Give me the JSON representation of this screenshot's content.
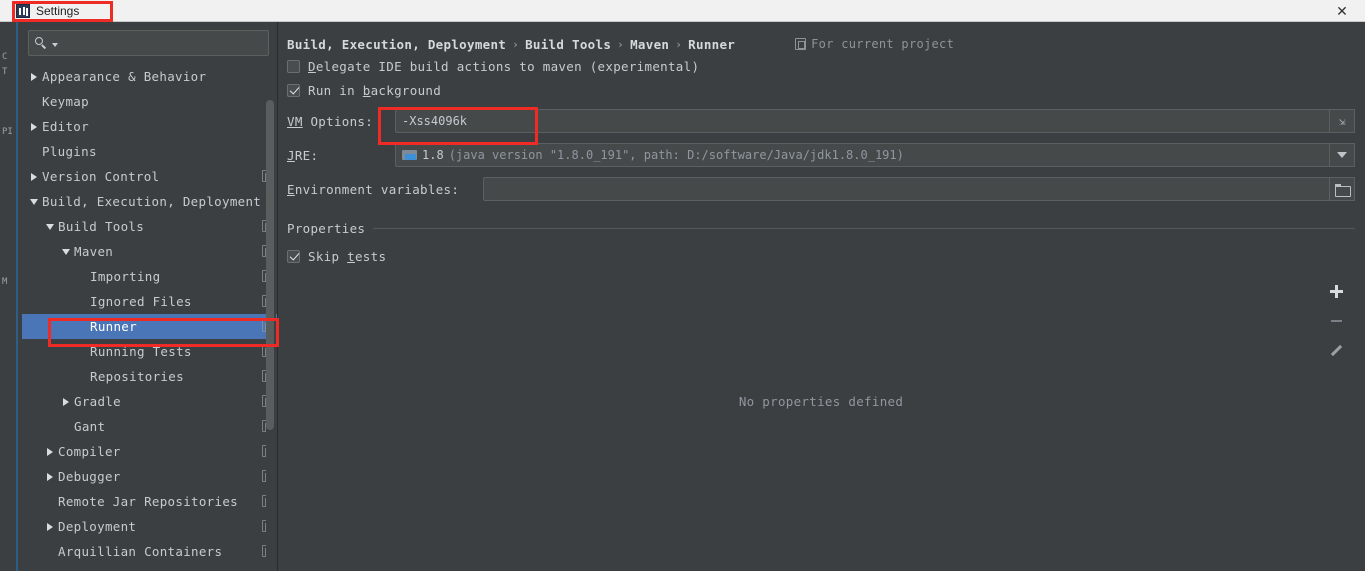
{
  "window": {
    "title": "Settings",
    "close_label": "✕",
    "icon": "ide-logo-icon"
  },
  "sidebar": {
    "search": {
      "value": "",
      "placeholder": ""
    },
    "items": [
      {
        "label": "Appearance & Behavior",
        "arrow": "right",
        "indent": 0,
        "scope_icon": false,
        "selected": false
      },
      {
        "label": "Keymap",
        "arrow": "none",
        "indent": 0,
        "scope_icon": false,
        "selected": false
      },
      {
        "label": "Editor",
        "arrow": "right",
        "indent": 0,
        "scope_icon": false,
        "selected": false
      },
      {
        "label": "Plugins",
        "arrow": "none",
        "indent": 0,
        "scope_icon": false,
        "selected": false
      },
      {
        "label": "Version Control",
        "arrow": "right",
        "indent": 0,
        "scope_icon": true,
        "selected": false
      },
      {
        "label": "Build, Execution, Deployment",
        "arrow": "down",
        "indent": 0,
        "scope_icon": false,
        "selected": false
      },
      {
        "label": "Build Tools",
        "arrow": "down",
        "indent": 1,
        "scope_icon": true,
        "selected": false
      },
      {
        "label": "Maven",
        "arrow": "down",
        "indent": 2,
        "scope_icon": true,
        "selected": false
      },
      {
        "label": "Importing",
        "arrow": "none",
        "indent": 3,
        "scope_icon": true,
        "selected": false
      },
      {
        "label": "Ignored Files",
        "arrow": "none",
        "indent": 3,
        "scope_icon": true,
        "selected": false
      },
      {
        "label": "Runner",
        "arrow": "none",
        "indent": 3,
        "scope_icon": true,
        "selected": true
      },
      {
        "label": "Running Tests",
        "arrow": "none",
        "indent": 3,
        "scope_icon": true,
        "selected": false
      },
      {
        "label": "Repositories",
        "arrow": "none",
        "indent": 3,
        "scope_icon": true,
        "selected": false
      },
      {
        "label": "Gradle",
        "arrow": "right",
        "indent": 2,
        "scope_icon": true,
        "selected": false
      },
      {
        "label": "Gant",
        "arrow": "none",
        "indent": 2,
        "scope_icon": true,
        "selected": false
      },
      {
        "label": "Compiler",
        "arrow": "right",
        "indent": 1,
        "scope_icon": true,
        "selected": false
      },
      {
        "label": "Debugger",
        "arrow": "right",
        "indent": 1,
        "scope_icon": true,
        "selected": false
      },
      {
        "label": "Remote Jar Repositories",
        "arrow": "none",
        "indent": 1,
        "scope_icon": true,
        "selected": false
      },
      {
        "label": "Deployment",
        "arrow": "right",
        "indent": 1,
        "scope_icon": true,
        "selected": false
      },
      {
        "label": "Arquillian Containers",
        "arrow": "none",
        "indent": 1,
        "scope_icon": true,
        "selected": false
      }
    ]
  },
  "main": {
    "breadcrumb": [
      "Build, Execution, Deployment",
      "Build Tools",
      "Maven",
      "Runner"
    ],
    "breadcrumb_separator": "›",
    "scope_badge": "For current project",
    "checkboxes": [
      {
        "label_mnemonic": "D",
        "label_rest": "elegate IDE build actions to maven (experimental)",
        "checked": false
      },
      {
        "label_pre": "Run in ",
        "label_mnemonic": "b",
        "label_rest": "ackground",
        "checked": true
      }
    ],
    "vm_options": {
      "label_mnemonic": "VM",
      "label_rest": " Options:",
      "value": "-Xss4096k",
      "expand_icon": "expand-arrows-icon"
    },
    "jre": {
      "label_mnemonic": "J",
      "label_rest": "RE:",
      "value_strong": "1.8",
      "value_dim": "(java version \"1.8.0_191\", path: D:/software/Java/jdk1.8.0_191)",
      "dropdown_icon": "chevron-down-icon"
    },
    "env_vars": {
      "label_mnemonic": "E",
      "label_rest": "nvironment variables:",
      "value": "",
      "browse_icon": "folder-icon"
    },
    "properties": {
      "section_title": "Properties",
      "skip_tests": {
        "label_pre": "Skip ",
        "label_mnemonic": "t",
        "label_rest": "ests",
        "checked": true
      },
      "empty_text": "No properties defined",
      "toolbar": [
        {
          "name": "add-property-button",
          "glyph": "+"
        },
        {
          "name": "remove-property-button",
          "glyph": "−"
        },
        {
          "name": "edit-property-button",
          "glyph": "✎"
        }
      ]
    }
  },
  "annotations": {
    "accent_color": "#ee2b24",
    "boxes": [
      "settings-title",
      "vm-options-field",
      "runner-tree-item"
    ]
  },
  "background_strip": {
    "fragments": [
      "C",
      "T",
      "PI",
      "M"
    ]
  }
}
